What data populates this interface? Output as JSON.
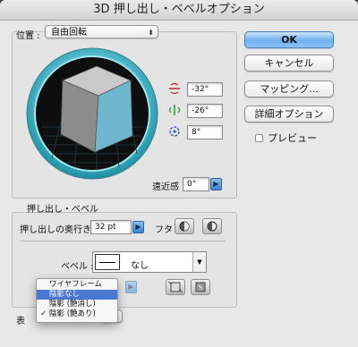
{
  "dialog": {
    "title": "3D 押し出し・ベベルオプション"
  },
  "buttons": {
    "ok": "OK",
    "cancel": "キャンセル",
    "mapping": "マッピング...",
    "more_options": "詳細オプション",
    "preview": "プレビュー"
  },
  "position": {
    "label": "位置 :",
    "value": "自由回転",
    "rotation_x": "-32°",
    "rotation_y": "-26°",
    "rotation_z": "8°",
    "perspective_label": "遠近感 :",
    "perspective_value": "0°"
  },
  "extrude": {
    "section_label": "押し出し・ベベル",
    "depth_label": "押し出しの奥行き :",
    "depth_value": "32 pt",
    "cap_label": "フタ :",
    "bevel_label": "ベベル :",
    "bevel_value": "なし"
  },
  "surface_menu": {
    "items": [
      {
        "label": "ワイヤフレーム",
        "checked": false,
        "highlighted": false
      },
      {
        "label": "陰影なし",
        "checked": false,
        "highlighted": true
      },
      {
        "label": "陰影 (艶消し)",
        "checked": false,
        "highlighted": false
      },
      {
        "label": "陰影 (艶あり)",
        "checked": true,
        "highlighted": false
      }
    ],
    "checkmark": "✓"
  },
  "surface": {
    "label_partial": "表"
  },
  "colors": {
    "trackball_outer": "#2bb5c8",
    "cube_top": "#c9c9c9",
    "cube_left": "#8c8c8c",
    "cube_right": "#6fb7cf",
    "highlight": "#4a78d0"
  }
}
